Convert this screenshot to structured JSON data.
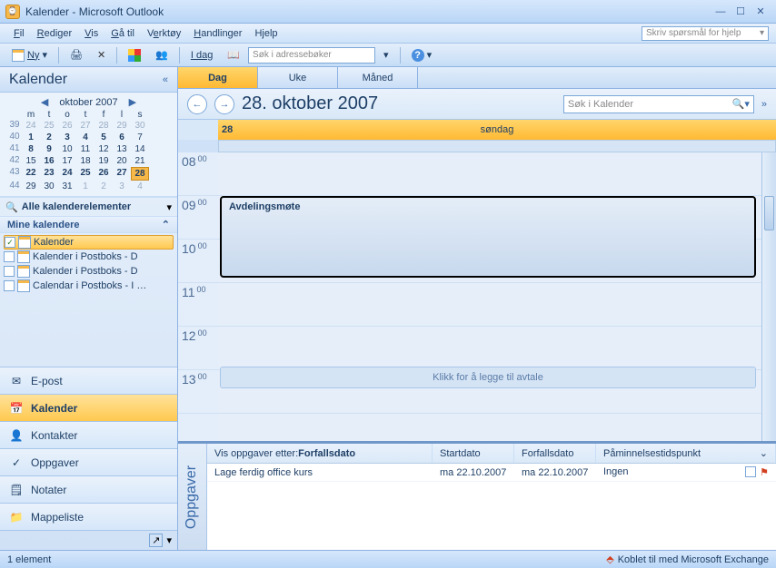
{
  "window_title": "Kalender - Microsoft Outlook",
  "menu": {
    "fil": "Fil",
    "rediger": "Rediger",
    "vis": "Vis",
    "ga_til": "Gå til",
    "verktoy": "Verktøy",
    "handlinger": "Handlinger",
    "hjelp": "Hjelp"
  },
  "help_placeholder": "Skriv spørsmål for hjelp",
  "toolbar": {
    "ny": "Ny",
    "idag": "I dag",
    "search_ab": "Søk i adressebøker"
  },
  "sidebar": {
    "title": "Kalender",
    "month_label": "oktober 2007",
    "dow": [
      "m",
      "t",
      "o",
      "t",
      "f",
      "l",
      "s"
    ],
    "weeks": [
      {
        "wk": "39",
        "days": [
          {
            "n": "24",
            "dim": true
          },
          {
            "n": "25",
            "dim": true
          },
          {
            "n": "26",
            "dim": true
          },
          {
            "n": "27",
            "dim": true
          },
          {
            "n": "28",
            "dim": true
          },
          {
            "n": "29",
            "dim": true
          },
          {
            "n": "30",
            "dim": true
          }
        ]
      },
      {
        "wk": "40",
        "days": [
          {
            "n": "1",
            "bold": true
          },
          {
            "n": "2",
            "bold": true
          },
          {
            "n": "3",
            "bold": true
          },
          {
            "n": "4",
            "bold": true
          },
          {
            "n": "5",
            "bold": true
          },
          {
            "n": "6",
            "bold": true
          },
          {
            "n": "7"
          }
        ]
      },
      {
        "wk": "41",
        "days": [
          {
            "n": "8",
            "bold": true
          },
          {
            "n": "9",
            "bold": true
          },
          {
            "n": "10"
          },
          {
            "n": "11"
          },
          {
            "n": "12"
          },
          {
            "n": "13"
          },
          {
            "n": "14"
          }
        ]
      },
      {
        "wk": "42",
        "days": [
          {
            "n": "15"
          },
          {
            "n": "16",
            "bold": true
          },
          {
            "n": "17"
          },
          {
            "n": "18"
          },
          {
            "n": "19"
          },
          {
            "n": "20"
          },
          {
            "n": "21"
          }
        ]
      },
      {
        "wk": "43",
        "days": [
          {
            "n": "22",
            "bold": true
          },
          {
            "n": "23",
            "bold": true
          },
          {
            "n": "24",
            "bold": true
          },
          {
            "n": "25",
            "bold": true
          },
          {
            "n": "26",
            "bold": true
          },
          {
            "n": "27",
            "bold": true
          },
          {
            "n": "28",
            "bold": true,
            "sel": true
          }
        ]
      },
      {
        "wk": "44",
        "days": [
          {
            "n": "29"
          },
          {
            "n": "30"
          },
          {
            "n": "31"
          },
          {
            "n": "1",
            "dim": true
          },
          {
            "n": "2",
            "dim": true
          },
          {
            "n": "3",
            "dim": true
          },
          {
            "n": "4",
            "dim": true
          }
        ]
      }
    ],
    "all_cal_elements": "Alle kalenderelementer",
    "my_calendars": "Mine kalendere",
    "calendars": [
      {
        "label": "Kalender",
        "checked": true,
        "active": true
      },
      {
        "label": "Kalender i Postboks - D",
        "checked": false
      },
      {
        "label": "Kalender i Postboks - D",
        "checked": false
      },
      {
        "label": "Calendar i Postboks - I …",
        "checked": false
      }
    ],
    "nav": [
      {
        "label": "E-post",
        "icon": "mail",
        "active": false
      },
      {
        "label": "Kalender",
        "icon": "calendar",
        "active": true
      },
      {
        "label": "Kontakter",
        "icon": "contacts",
        "active": false
      },
      {
        "label": "Oppgaver",
        "icon": "tasks",
        "active": false
      },
      {
        "label": "Notater",
        "icon": "notes",
        "active": false
      },
      {
        "label": "Mappeliste",
        "icon": "folders",
        "active": false
      }
    ]
  },
  "view_tabs": {
    "dag": "Dag",
    "uke": "Uke",
    "maned": "Måned"
  },
  "date_title": "28. oktober 2007",
  "cal_search_placeholder": "Søk i Kalender",
  "day_header": {
    "num": "28",
    "name": "søndag"
  },
  "hours": [
    "08",
    "09",
    "10",
    "11",
    "12",
    "13"
  ],
  "minute_label": "00",
  "appointment_title": "Avdelingsmøte",
  "add_hint": "Klikk for å legge til avtale",
  "tasks": {
    "side_label": "Oppgaver",
    "header_prefix": "Vis oppgaver etter: ",
    "header_sort": "Forfallsdato",
    "cols": {
      "start": "Startdato",
      "due": "Forfallsdato",
      "reminder": "Påminnelsestidspunkt"
    },
    "rows": [
      {
        "title": "Lage ferdig office kurs",
        "start": "ma 22.10.2007",
        "due": "ma 22.10.2007",
        "reminder": "Ingen"
      }
    ]
  },
  "status": {
    "left": "1 element",
    "right": "Koblet til med Microsoft Exchange"
  }
}
